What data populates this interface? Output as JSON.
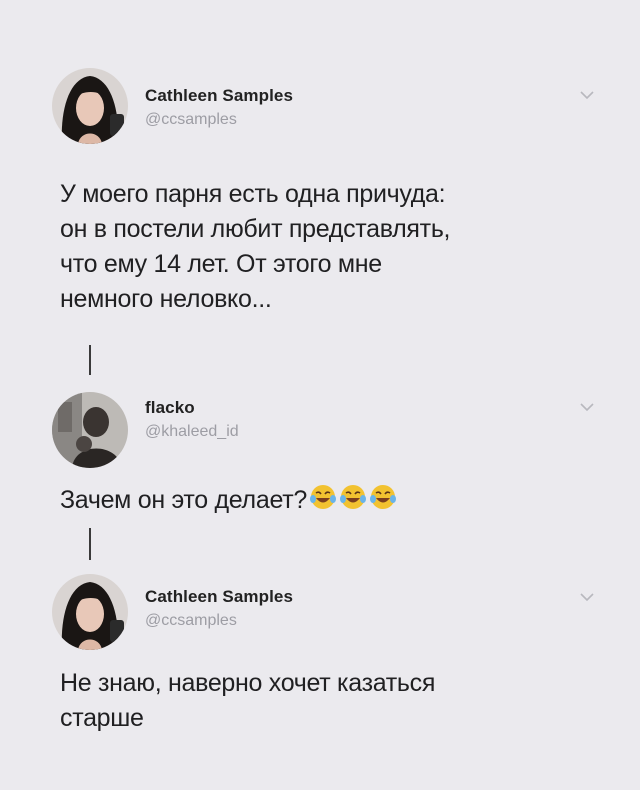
{
  "tweets": [
    {
      "name": "Cathleen Samples",
      "handle": "@ccsamples",
      "text_lines": [
        "У моего парня есть одна причуда:",
        "он в постели любит представлять,",
        "что ему 14 лет. От этого мне",
        "немного неловко..."
      ]
    },
    {
      "name": "flacko",
      "handle": "@khaleed_id",
      "text_lines": [
        "Зачем он это делает?"
      ],
      "emojis": [
        "face-with-tears-of-joy-icon",
        "face-with-tears-of-joy-icon",
        "face-with-tears-of-joy-icon"
      ]
    },
    {
      "name": "Cathleen Samples",
      "handle": "@ccsamples",
      "text_lines": [
        "Не знаю, наверно хочет казаться",
        "старше"
      ]
    }
  ],
  "colors": {
    "background": "#ebeaee",
    "text": "#202022",
    "handle": "#9d9da4",
    "thread_line": "#3a3a3a"
  }
}
